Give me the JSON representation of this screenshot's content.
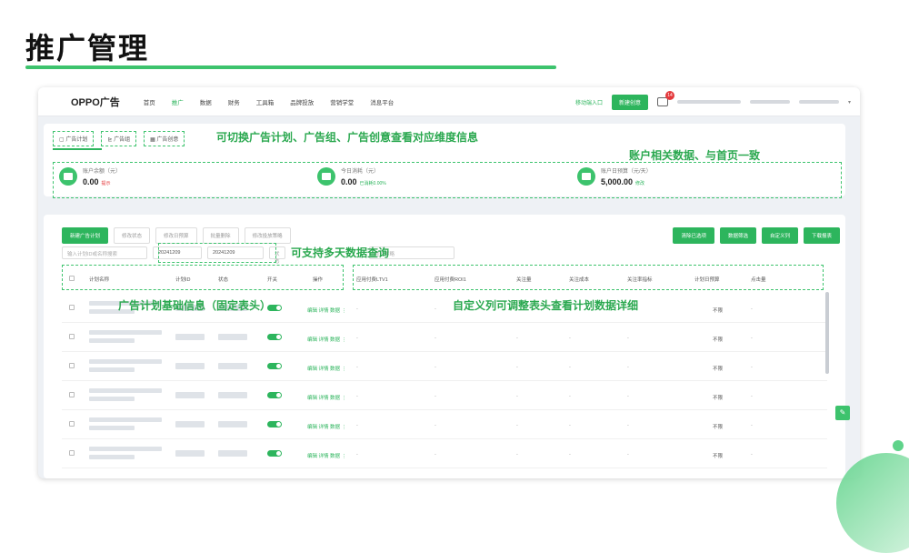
{
  "slide": {
    "title": "推广管理"
  },
  "topbar": {
    "logo": "OPPO广告",
    "nav": [
      "首页",
      "推广",
      "数据",
      "财务",
      "工具箱",
      "品牌投放",
      "营销学堂",
      "消息平台"
    ],
    "active_nav": "推广",
    "mobile_link": "移动端入口",
    "new_button": "新建创意",
    "badge_count": "14"
  },
  "tabs": [
    "广告计划",
    "广告组",
    "广告创意"
  ],
  "annotations": {
    "tabs_note": "可切换广告计划、广告组、广告创意查看对应维度信息",
    "metrics_note": "账户相关数据、与首页一致",
    "date_note": "可支持多天数据查询",
    "fixed_header_note": "广告计划基础信息（固定表头）",
    "custom_columns_note": "自定义列可调整表头查看计划数据详细"
  },
  "metrics": [
    {
      "label": "账户余额（元）",
      "value": "0.00",
      "extra": "提示"
    },
    {
      "label": "今日消耗（元）",
      "value": "0.00",
      "extra": "已消耗0.00%"
    },
    {
      "label": "账户日预算（元/天）",
      "value": "5,000.00",
      "extra": "修改"
    }
  ],
  "buttons_left": [
    "新建广告计划",
    "修改状态",
    "修改日预算",
    "批量删除",
    "修改投放策略"
  ],
  "buttons_right": [
    "清除已选项",
    "数据筛选",
    "自定义列",
    "下载报表"
  ],
  "filters": {
    "search_placeholder": "输入计划ID或名称搜索",
    "date_start": "20241209",
    "date_end": "20241209",
    "status_placeholder": "状态",
    "strategy_placeholder": "竞价策略"
  },
  "table": {
    "left_headers": [
      "计划名称",
      "计划ID",
      "状态",
      "开关",
      "操作"
    ],
    "right_headers": [
      "应用付费LTV1",
      "应用付费ROI1",
      "关注量",
      "关注成本",
      "关注率指标",
      "计划日预算",
      "点击量"
    ],
    "row_action": "编辑 详情 数据",
    "row_budget": "不限",
    "row_dash": "-"
  },
  "colors": {
    "accent": "#2db55d",
    "annotation": "#2aa84f"
  }
}
